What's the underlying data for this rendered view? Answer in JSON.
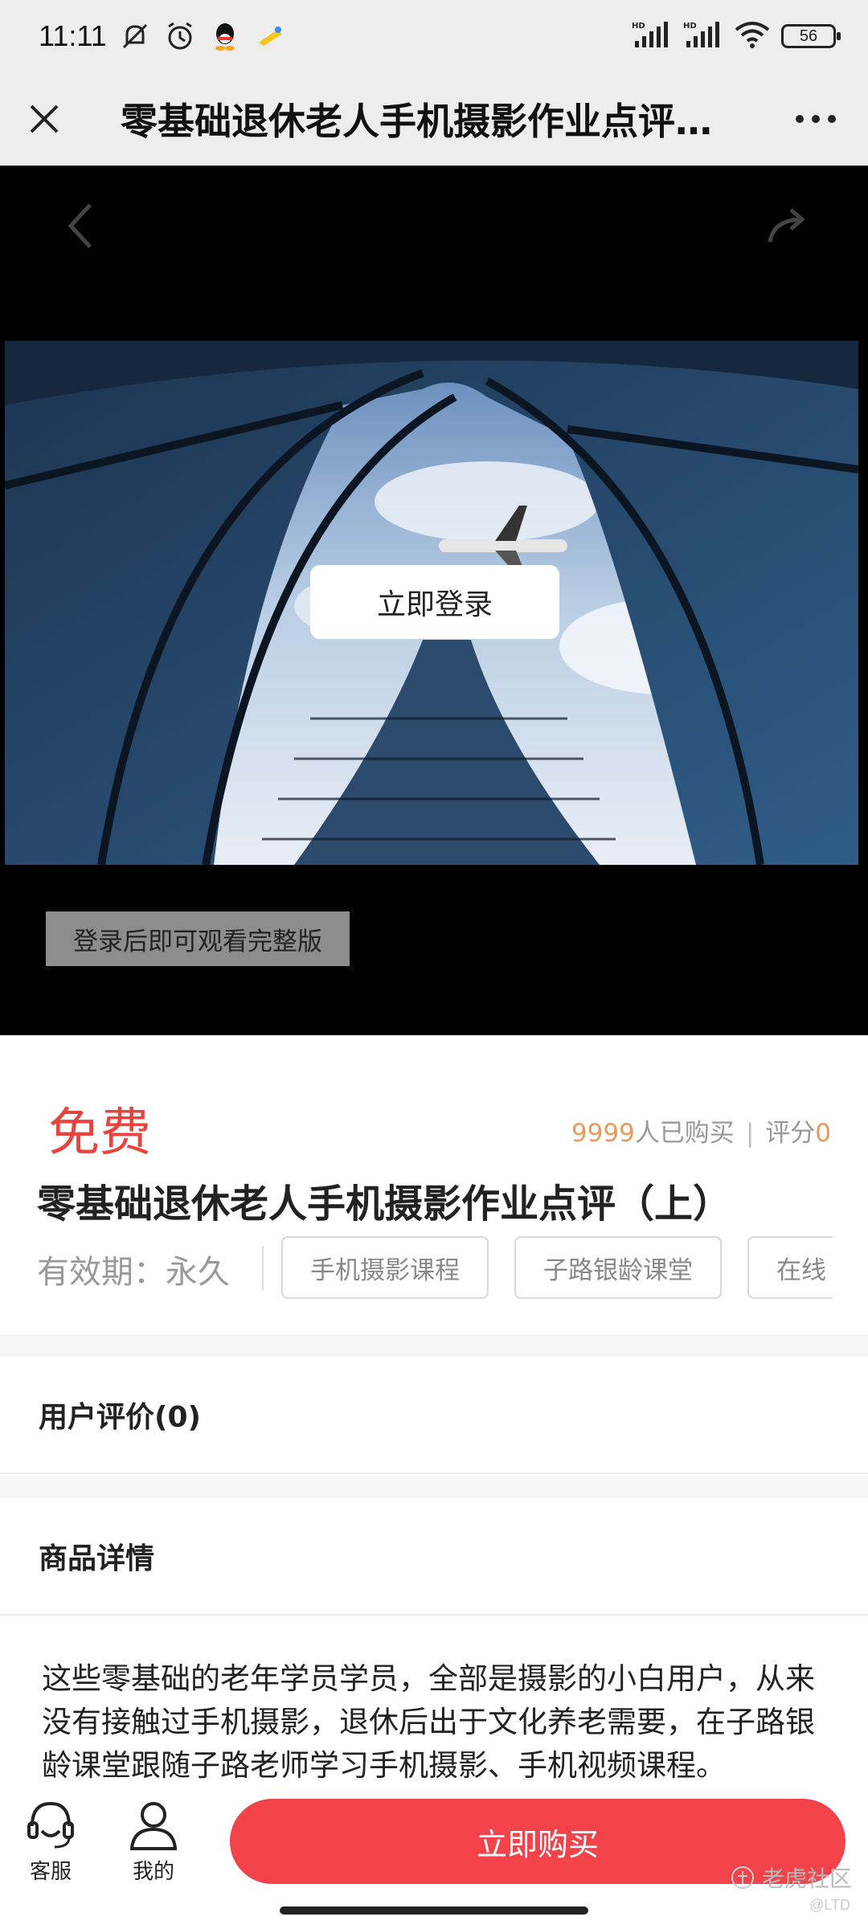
{
  "status_bar": {
    "time": "11:11",
    "battery": "56",
    "icons": [
      "mute-icon",
      "alarm-icon",
      "qq-icon",
      "app-icon",
      "hd-signal-icon",
      "hd-signal-icon",
      "wifi-icon",
      "battery-icon"
    ]
  },
  "header": {
    "title": "零基础退休老人手机摄影作业点评（上）",
    "close_icon": "close-icon",
    "more_icon": "more-icon"
  },
  "video": {
    "login_button": "立即登录",
    "preview_tip": "登录后即可观看完整版",
    "back_icon": "chevron-left-icon",
    "share_icon": "share-icon"
  },
  "product": {
    "price": "免费",
    "purchase_count": "9999",
    "purchase_suffix": "人已购买",
    "separator": "|",
    "rating_label": "评分",
    "rating_value": "0",
    "title": "零基础退休老人手机摄影作业点评（上）",
    "validity_label": "有效期：",
    "validity_value": "永久",
    "tags": [
      "手机摄影课程",
      "子路银龄课堂",
      "在线"
    ]
  },
  "sections": {
    "reviews": "用户评价(0)",
    "details": "商品详情"
  },
  "description": "这些零基础的老年学员学员，全部是摄影的小白用户，从来没有接触过手机摄影，退休后出于文化养老需要，在子路银龄课堂跟随子路老师学习手机摄影、手机视频课程。",
  "bottom_bar": {
    "service_label": "客服",
    "mine_label": "我的",
    "buy_button": "立即购买"
  },
  "watermark": {
    "text": "老虎社区",
    "sub": "@LTD"
  },
  "colors": {
    "accent_red": "#f2434a",
    "price_red": "#e8433c",
    "count_orange": "#e89a5a"
  }
}
